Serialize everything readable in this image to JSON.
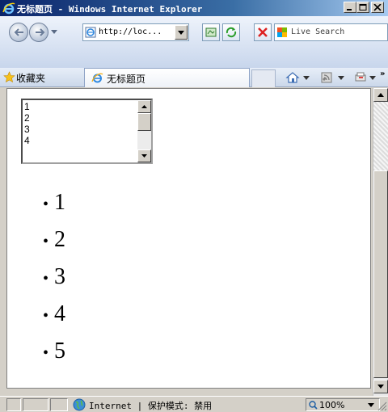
{
  "window": {
    "title": "无标题页 - Windows Internet Explorer"
  },
  "address": {
    "url": "http://loc..."
  },
  "search": {
    "placeholder": "Live Search"
  },
  "favorites": {
    "label": "收藏夹"
  },
  "tab": {
    "title": "无标题页"
  },
  "page": {
    "listbox_options": [
      "1",
      "2",
      "3",
      "4"
    ],
    "bullet_items": [
      "1",
      "2",
      "3",
      "4",
      "5"
    ]
  },
  "status": {
    "zone": "Internet | 保护模式: 禁用",
    "zoom": "100%"
  },
  "colors": {
    "title_gradient_start": "#0a246a",
    "chrome_gray": "#d4d0c8",
    "address_border": "#7f9db9"
  }
}
